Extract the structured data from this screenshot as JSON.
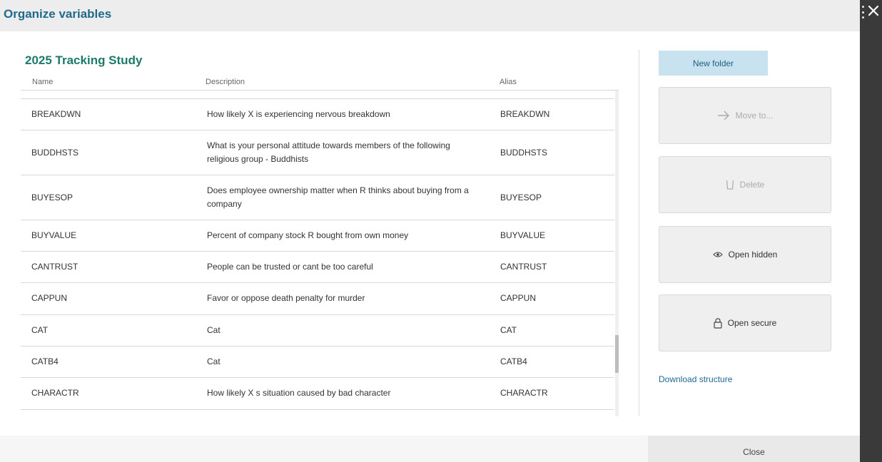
{
  "dialog": {
    "title": "Organize variables"
  },
  "study": {
    "title": "2025 Tracking Study"
  },
  "table": {
    "columns": [
      "Name",
      "Description",
      "Alias"
    ],
    "rows": [
      {
        "name": "BREAKDWN",
        "description": "How likely X is experiencing nervous breakdown",
        "alias": "BREAKDWN"
      },
      {
        "name": "BUDDHSTS",
        "description": "What is your personal attitude towards members of the following religious group - Buddhists",
        "alias": "BUDDHSTS"
      },
      {
        "name": "BUYESOP",
        "description": "Does employee ownership matter when R thinks about buying from a company",
        "alias": "BUYESOP"
      },
      {
        "name": "BUYVALUE",
        "description": "Percent of company stock R bought from own money",
        "alias": "BUYVALUE"
      },
      {
        "name": "CANTRUST",
        "description": "People can be trusted or cant be too careful",
        "alias": "CANTRUST"
      },
      {
        "name": "CAPPUN",
        "description": "Favor or oppose death penalty for murder",
        "alias": "CAPPUN"
      },
      {
        "name": "CAT",
        "description": "Cat",
        "alias": "CAT"
      },
      {
        "name": "CATB4",
        "description": "Cat",
        "alias": "CATB4"
      },
      {
        "name": "CHARACTR",
        "description": "How likely X s situation caused by bad character",
        "alias": "CHARACTR"
      }
    ]
  },
  "actions": {
    "new_folder": "New folder",
    "move_to": "Move to...",
    "delete": "Delete",
    "open_hidden": "Open hidden",
    "open_secure": "Open secure",
    "download_structure": "Download structure"
  },
  "footer": {
    "close": "Close"
  },
  "icons": {
    "close": "close-icon",
    "move": "arrow-right-icon",
    "delete": "trash-icon",
    "hidden": "eye-icon",
    "secure": "lock-icon",
    "menu": "drag-dots-icon"
  }
}
